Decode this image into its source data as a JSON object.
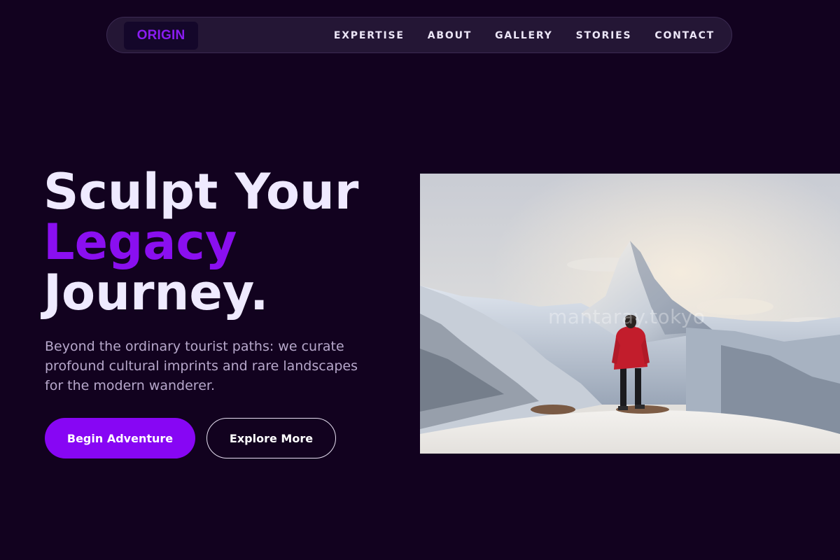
{
  "brand": {
    "logo_text": "ORIGIN",
    "accent_color": "#8a0ff0",
    "background_color": "#12021f"
  },
  "nav": {
    "links": [
      "EXPERTISE",
      "ABOUT",
      "GALLERY",
      "STORIES",
      "CONTACT"
    ]
  },
  "hero": {
    "headline_line1": "Sculpt Your",
    "headline_line2": "Legacy",
    "headline_line3": "Journey.",
    "subtext": "Beyond the ordinary tourist paths: we curate profound cultural imprints and rare landscapes for the modern wanderer.",
    "primary_button": "Begin Adventure",
    "secondary_button": "Explore More",
    "image": {
      "subject": "hiker in red jacket facing snowy mountain peak",
      "watermark": "mantaray.tokyo"
    }
  }
}
